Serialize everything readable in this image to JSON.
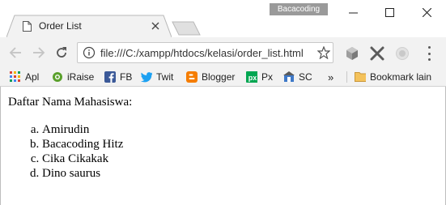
{
  "window": {
    "profile_badge": "Bacacoding"
  },
  "tab": {
    "title": "Order List"
  },
  "toolbar": {
    "url": "file:///C:/xampp/htdocs/kelasi/order_list.html"
  },
  "bookmarks": {
    "items": [
      {
        "label": "Apl",
        "icon": "apps-grid-icon"
      },
      {
        "label": "iRaise",
        "icon": "iraise-icon"
      },
      {
        "label": "FB",
        "icon": "facebook-icon"
      },
      {
        "label": "Twit",
        "icon": "twitter-icon"
      },
      {
        "label": "Blogger",
        "icon": "blogger-icon"
      },
      {
        "label": "Px",
        "icon": "px-icon"
      },
      {
        "label": "SC",
        "icon": "sc-icon"
      }
    ],
    "more": "»",
    "other_label": "Bookmark lain"
  },
  "page": {
    "heading": "Daftar Nama Mahasiswa:",
    "items": [
      "Amirudin",
      "Bacacoding Hitz",
      "Cika Cikakak",
      "Dino saurus"
    ]
  },
  "colors": {
    "facebook": "#3b5998",
    "twitter": "#1da1f2",
    "blogger": "#f57d00",
    "px": "#00a651",
    "folder": "#f4c25b"
  }
}
